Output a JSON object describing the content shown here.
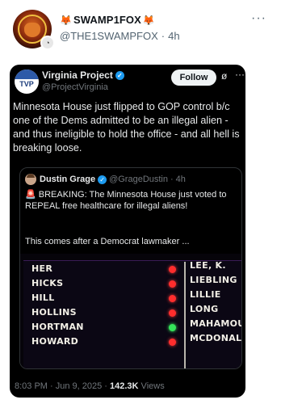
{
  "post": {
    "display_name": "SWAMP1FOX",
    "handle": "@THE1SWAMPFOX",
    "separator": "·",
    "age": "4h",
    "more": "···"
  },
  "shot": {
    "author": "Virginia Project",
    "handle": "@ProjectVirginia",
    "avatar_text": "TVP",
    "follow_label": "Follow",
    "more": "···",
    "text": "Minnesota House just flipped to GOP control b/c one of the Dems admitted to be an illegal alien - and thus ineligible to hold the office - and all hell is breaking loose.",
    "quote": {
      "author": "Dustin Grage",
      "handle": "@GrageDustin",
      "separator": "·",
      "age": "4h",
      "text": "🚨 BREAKING: The Minnesota House just voted to REPEAL free healthcare for illegal aliens!",
      "text2": "This comes after a Democrat lawmaker ...",
      "board": {
        "left_names": [
          "HER",
          "HICKS",
          "HILL",
          "HOLLINS",
          "HORTMAN",
          "HOWARD"
        ],
        "right_names": [
          "LEE, K.",
          "LIEBLING",
          "LILLIE",
          "LONG",
          "MAHAMOU",
          "MCDONALI"
        ],
        "vote_colors": [
          "red",
          "red",
          "red",
          "red",
          "green",
          "red"
        ]
      }
    },
    "footer": {
      "time": "8:03 PM · Jun 9, 2025 · ",
      "views_count": "142.3K",
      "views_label": " Views"
    }
  },
  "colors": {
    "accent": "#1d9bf0",
    "vote_red": "#ff2d2d",
    "vote_green": "#35e35a"
  },
  "icons": [
    "fox-emoji",
    "verified-badge",
    "grok-icon",
    "more-icon",
    "siren-emoji"
  ]
}
